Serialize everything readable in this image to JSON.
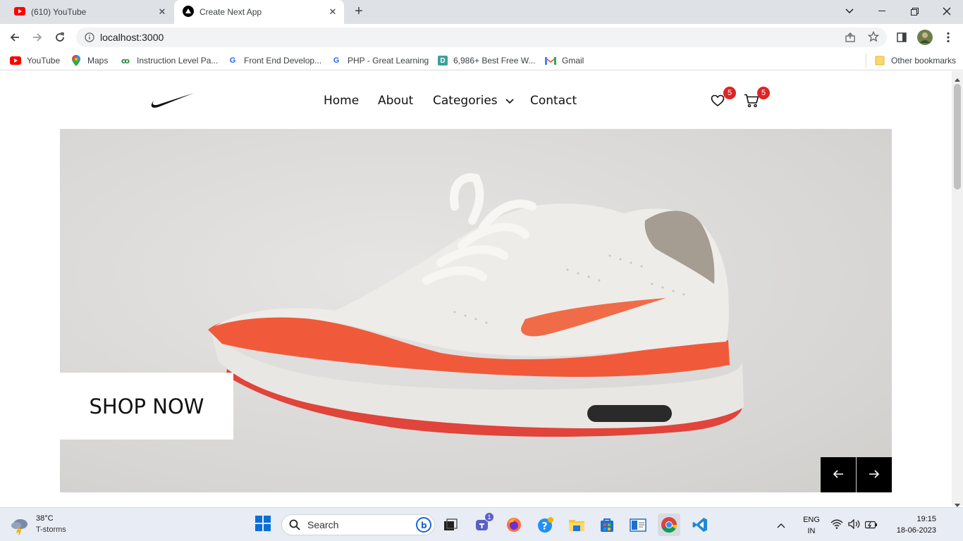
{
  "browser": {
    "tabs": [
      {
        "title": "(610) YouTube",
        "active": false
      },
      {
        "title": "Create Next App",
        "active": true
      }
    ],
    "url": "localhost:3000",
    "bookmarks": [
      {
        "label": "YouTube",
        "icon": "youtube-icon"
      },
      {
        "label": "Maps",
        "icon": "maps-icon"
      },
      {
        "label": "Instruction Level Pa...",
        "icon": "geeks-icon"
      },
      {
        "label": "Front End Develop...",
        "icon": "great-learning-icon"
      },
      {
        "label": "PHP - Great Learning",
        "icon": "great-learning-icon"
      },
      {
        "label": "6,986+ Best Free W...",
        "icon": "d-icon"
      },
      {
        "label": "Gmail",
        "icon": "gmail-icon"
      }
    ],
    "other_bookmarks": "Other bookmarks"
  },
  "site": {
    "nav": {
      "home": "Home",
      "about": "About",
      "categories": "Categories",
      "contact": "Contact"
    },
    "wishlist_count": "5",
    "cart_count": "5",
    "hero": {
      "cta": "SHOP NOW"
    }
  },
  "taskbar": {
    "weather_temp": "38°C",
    "weather_desc": "T-storms",
    "search_placeholder": "Search",
    "teams_badge": "1",
    "lang_top": "ENG",
    "lang_bottom": "IN",
    "time": "19:15",
    "date": "18-06-2023"
  },
  "colors": {
    "badge": "#e02424",
    "shoe_orange": "#f05a3a"
  }
}
